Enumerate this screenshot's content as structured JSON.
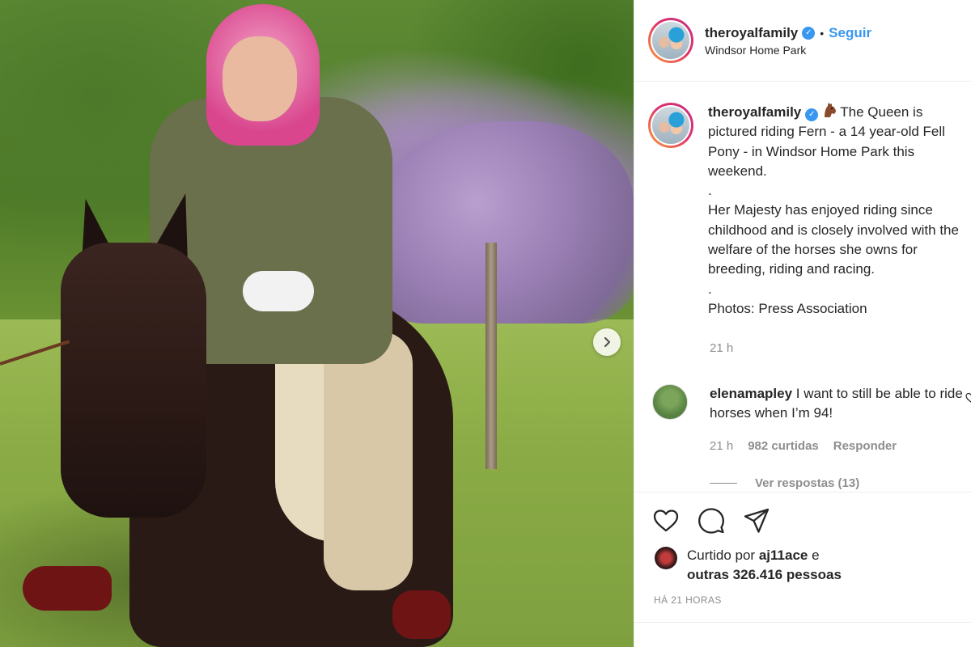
{
  "post": {
    "username": "theroyalfamily",
    "follow_label": "Seguir",
    "dot": "•",
    "location": "Windsor Home Park",
    "verified_icon": "verified-badge-icon"
  },
  "caption": {
    "username": "theroyalfamily",
    "emoji": "horse-face-icon",
    "line1": "The Queen is pictured riding Fern - a 14 year-old Fell Pony - in Windsor Home Park this weekend.",
    "sep1": ".",
    "line2": "Her Majesty has enjoyed riding since childhood and is closely involved with the welfare of the horses she owns for breeding, riding and racing.",
    "sep2": ".",
    "line3": "Photos: Press Association",
    "time": "21 h"
  },
  "comment": {
    "username": "elenamapley",
    "text": "I want to still be able to ride horses when I’m 94!",
    "time": "21 h",
    "likes": "982 curtidas",
    "reply_label": "Responder",
    "view_replies": "Ver respostas (13)"
  },
  "likes": {
    "prefix": "Curtido por",
    "user": "aj11ace",
    "conjunction": "e",
    "others": "outras 326.416 pessoas"
  },
  "timestamp": "HÁ 21 HORAS",
  "colors": {
    "accent_blue": "#3897f0",
    "muted": "#8e8e8e",
    "text": "#262626"
  }
}
